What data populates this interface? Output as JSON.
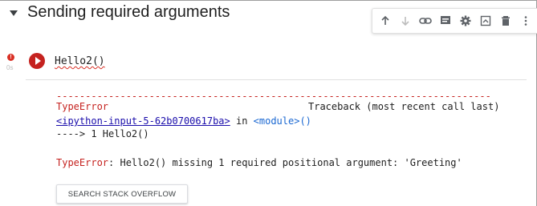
{
  "section": {
    "title": "Sending required arguments"
  },
  "cell": {
    "code": "Hello2()",
    "error_badge": "!",
    "exec_time": "0s"
  },
  "toolbar": {
    "icons": [
      "move-up-icon",
      "move-down-icon",
      "link-icon",
      "comment-icon",
      "settings-icon",
      "mirror-cell-icon",
      "delete-icon",
      "more-icon"
    ]
  },
  "output": {
    "dashes": "---------------------------------------------------------------------------",
    "error_type": "TypeError",
    "traceback_header": "Traceback (most recent call last)",
    "input_link": "<ipython-input-5-62b0700617ba>",
    "in_word": " in ",
    "module": "<module>()",
    "arrow_line": "----> 1 Hello2()",
    "error_prefix": "TypeError",
    "error_message": ": Hello2() missing 1 required positional argument: 'Greeting'",
    "stackoverflow_button": "SEARCH STACK OVERFLOW"
  }
}
